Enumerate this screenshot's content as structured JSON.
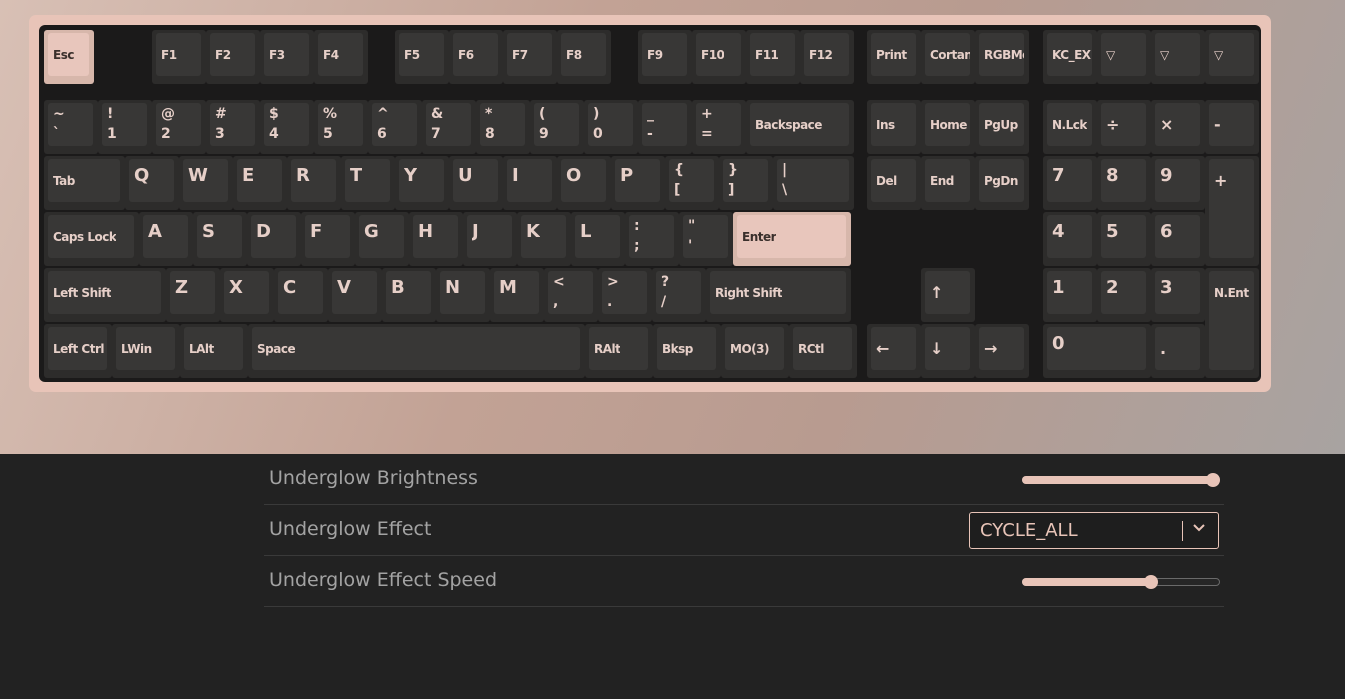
{
  "colors": {
    "accent": "#e8c4b8",
    "keycap": "#383736",
    "page_background": "#222222"
  },
  "keyboard": {
    "rows": [
      {
        "keys": [
          {
            "id": "esc",
            "l": "Esc",
            "selected": true
          },
          {
            "id": "f1",
            "l": "F1"
          },
          {
            "id": "f2",
            "l": "F2"
          },
          {
            "id": "f3",
            "l": "F3"
          },
          {
            "id": "f4",
            "l": "F4"
          },
          {
            "id": "f5",
            "l": "F5"
          },
          {
            "id": "f6",
            "l": "F6"
          },
          {
            "id": "f7",
            "l": "F7"
          },
          {
            "id": "f8",
            "l": "F8"
          },
          {
            "id": "f9",
            "l": "F9"
          },
          {
            "id": "f10",
            "l": "F10"
          },
          {
            "id": "f11",
            "l": "F11"
          },
          {
            "id": "f12",
            "l": "F12"
          },
          {
            "id": "print",
            "l": "Print"
          },
          {
            "id": "cortana",
            "l": "Cortan"
          },
          {
            "id": "rgbmode",
            "l": "RGBMo"
          },
          {
            "id": "kc-ext",
            "l": "KC_EX"
          },
          {
            "id": "macro-1",
            "l": "▽"
          },
          {
            "id": "macro-2",
            "l": "▽"
          },
          {
            "id": "macro-3",
            "l": "▽"
          }
        ]
      },
      {
        "keys": [
          {
            "id": "grave",
            "t": "~",
            "b": "`"
          },
          {
            "id": "1",
            "t": "!",
            "b": "1"
          },
          {
            "id": "2",
            "t": "@",
            "b": "2"
          },
          {
            "id": "3",
            "t": "#",
            "b": "3"
          },
          {
            "id": "4",
            "t": "$",
            "b": "4"
          },
          {
            "id": "5",
            "t": "%",
            "b": "5"
          },
          {
            "id": "6",
            "t": "^",
            "b": "6"
          },
          {
            "id": "7",
            "t": "&",
            "b": "7"
          },
          {
            "id": "8",
            "t": "*",
            "b": "8"
          },
          {
            "id": "9",
            "t": "(",
            "b": "9"
          },
          {
            "id": "0",
            "t": ")",
            "b": "0"
          },
          {
            "id": "minus",
            "t": "_",
            "b": "-"
          },
          {
            "id": "equal",
            "t": "+",
            "b": "="
          },
          {
            "id": "backspace",
            "l": "Backspace"
          },
          {
            "id": "ins",
            "l": "Ins"
          },
          {
            "id": "home",
            "l": "Home"
          },
          {
            "id": "pgup",
            "l": "PgUp"
          },
          {
            "id": "numlock",
            "l": "N.Lck"
          },
          {
            "id": "kp-divide",
            "s": "÷"
          },
          {
            "id": "kp-multiply",
            "s": "×"
          },
          {
            "id": "kp-minus",
            "s": "-"
          }
        ]
      },
      {
        "keys": [
          {
            "id": "tab",
            "l": "Tab"
          },
          {
            "id": "q",
            "g": "Q"
          },
          {
            "id": "w",
            "g": "W"
          },
          {
            "id": "e",
            "g": "E"
          },
          {
            "id": "r",
            "g": "R"
          },
          {
            "id": "t",
            "g": "T"
          },
          {
            "id": "y",
            "g": "Y"
          },
          {
            "id": "u",
            "g": "U"
          },
          {
            "id": "i",
            "g": "I"
          },
          {
            "id": "o",
            "g": "O"
          },
          {
            "id": "p",
            "g": "P"
          },
          {
            "id": "lbracket",
            "t": "{",
            "b": "["
          },
          {
            "id": "rbracket",
            "t": "}",
            "b": "]"
          },
          {
            "id": "backslash",
            "t": "|",
            "b": "\\"
          },
          {
            "id": "del",
            "l": "Del"
          },
          {
            "id": "end",
            "l": "End"
          },
          {
            "id": "pgdn",
            "l": "PgDn"
          },
          {
            "id": "kp-7",
            "g": "7"
          },
          {
            "id": "kp-8",
            "g": "8"
          },
          {
            "id": "kp-9",
            "g": "9"
          },
          {
            "id": "kp-plus",
            "s": "+"
          }
        ]
      },
      {
        "keys": [
          {
            "id": "capslock",
            "l": "Caps Lock"
          },
          {
            "id": "a",
            "g": "A"
          },
          {
            "id": "s",
            "g": "S"
          },
          {
            "id": "d",
            "g": "D"
          },
          {
            "id": "f",
            "g": "F"
          },
          {
            "id": "g",
            "g": "G"
          },
          {
            "id": "h",
            "g": "H"
          },
          {
            "id": "j",
            "g": "J"
          },
          {
            "id": "k",
            "g": "K"
          },
          {
            "id": "l",
            "g": "L"
          },
          {
            "id": "semicolon",
            "t": ":",
            "b": ";"
          },
          {
            "id": "quote",
            "t": "\"",
            "b": "'"
          },
          {
            "id": "enter",
            "l": "Enter",
            "selected": true
          },
          {
            "id": "kp-4",
            "g": "4"
          },
          {
            "id": "kp-5",
            "g": "5"
          },
          {
            "id": "kp-6",
            "g": "6"
          }
        ]
      },
      {
        "keys": [
          {
            "id": "lshift",
            "l": "Left Shift"
          },
          {
            "id": "z",
            "g": "Z"
          },
          {
            "id": "x",
            "g": "X"
          },
          {
            "id": "c",
            "g": "C"
          },
          {
            "id": "v",
            "g": "V"
          },
          {
            "id": "b",
            "g": "B"
          },
          {
            "id": "n",
            "g": "N"
          },
          {
            "id": "m",
            "g": "M"
          },
          {
            "id": "comma",
            "t": "<",
            "b": ","
          },
          {
            "id": "period",
            "t": ">",
            "b": "."
          },
          {
            "id": "slash",
            "t": "?",
            "b": "/"
          },
          {
            "id": "rshift",
            "l": "Right Shift"
          },
          {
            "id": "up",
            "s": "↑"
          },
          {
            "id": "kp-1",
            "g": "1"
          },
          {
            "id": "kp-2",
            "g": "2"
          },
          {
            "id": "kp-3",
            "g": "3"
          },
          {
            "id": "kp-enter",
            "l": "N.Ent"
          }
        ]
      },
      {
        "keys": [
          {
            "id": "lctrl",
            "l": "Left Ctrl"
          },
          {
            "id": "lwin",
            "l": "LWin"
          },
          {
            "id": "lalt",
            "l": "LAlt"
          },
          {
            "id": "space",
            "l": "Space"
          },
          {
            "id": "ralt",
            "l": "RAlt"
          },
          {
            "id": "bksp2",
            "l": "Bksp"
          },
          {
            "id": "mo3",
            "l": "MO(3)"
          },
          {
            "id": "rctrl",
            "l": "RCtl"
          },
          {
            "id": "left",
            "s": "←"
          },
          {
            "id": "down",
            "s": "↓"
          },
          {
            "id": "right",
            "s": "→"
          },
          {
            "id": "kp-0",
            "g": "0"
          },
          {
            "id": "kp-dot",
            "s": "."
          }
        ]
      }
    ]
  },
  "settings": [
    {
      "id": "underglow-brightness",
      "label": "Underglow Brightness",
      "type": "slider",
      "value": 1.0
    },
    {
      "id": "underglow-effect",
      "label": "Underglow Effect",
      "type": "select",
      "value": "CYCLE_ALL"
    },
    {
      "id": "underglow-effect-speed",
      "label": "Underglow Effect Speed",
      "type": "slider",
      "value": 0.65
    }
  ]
}
